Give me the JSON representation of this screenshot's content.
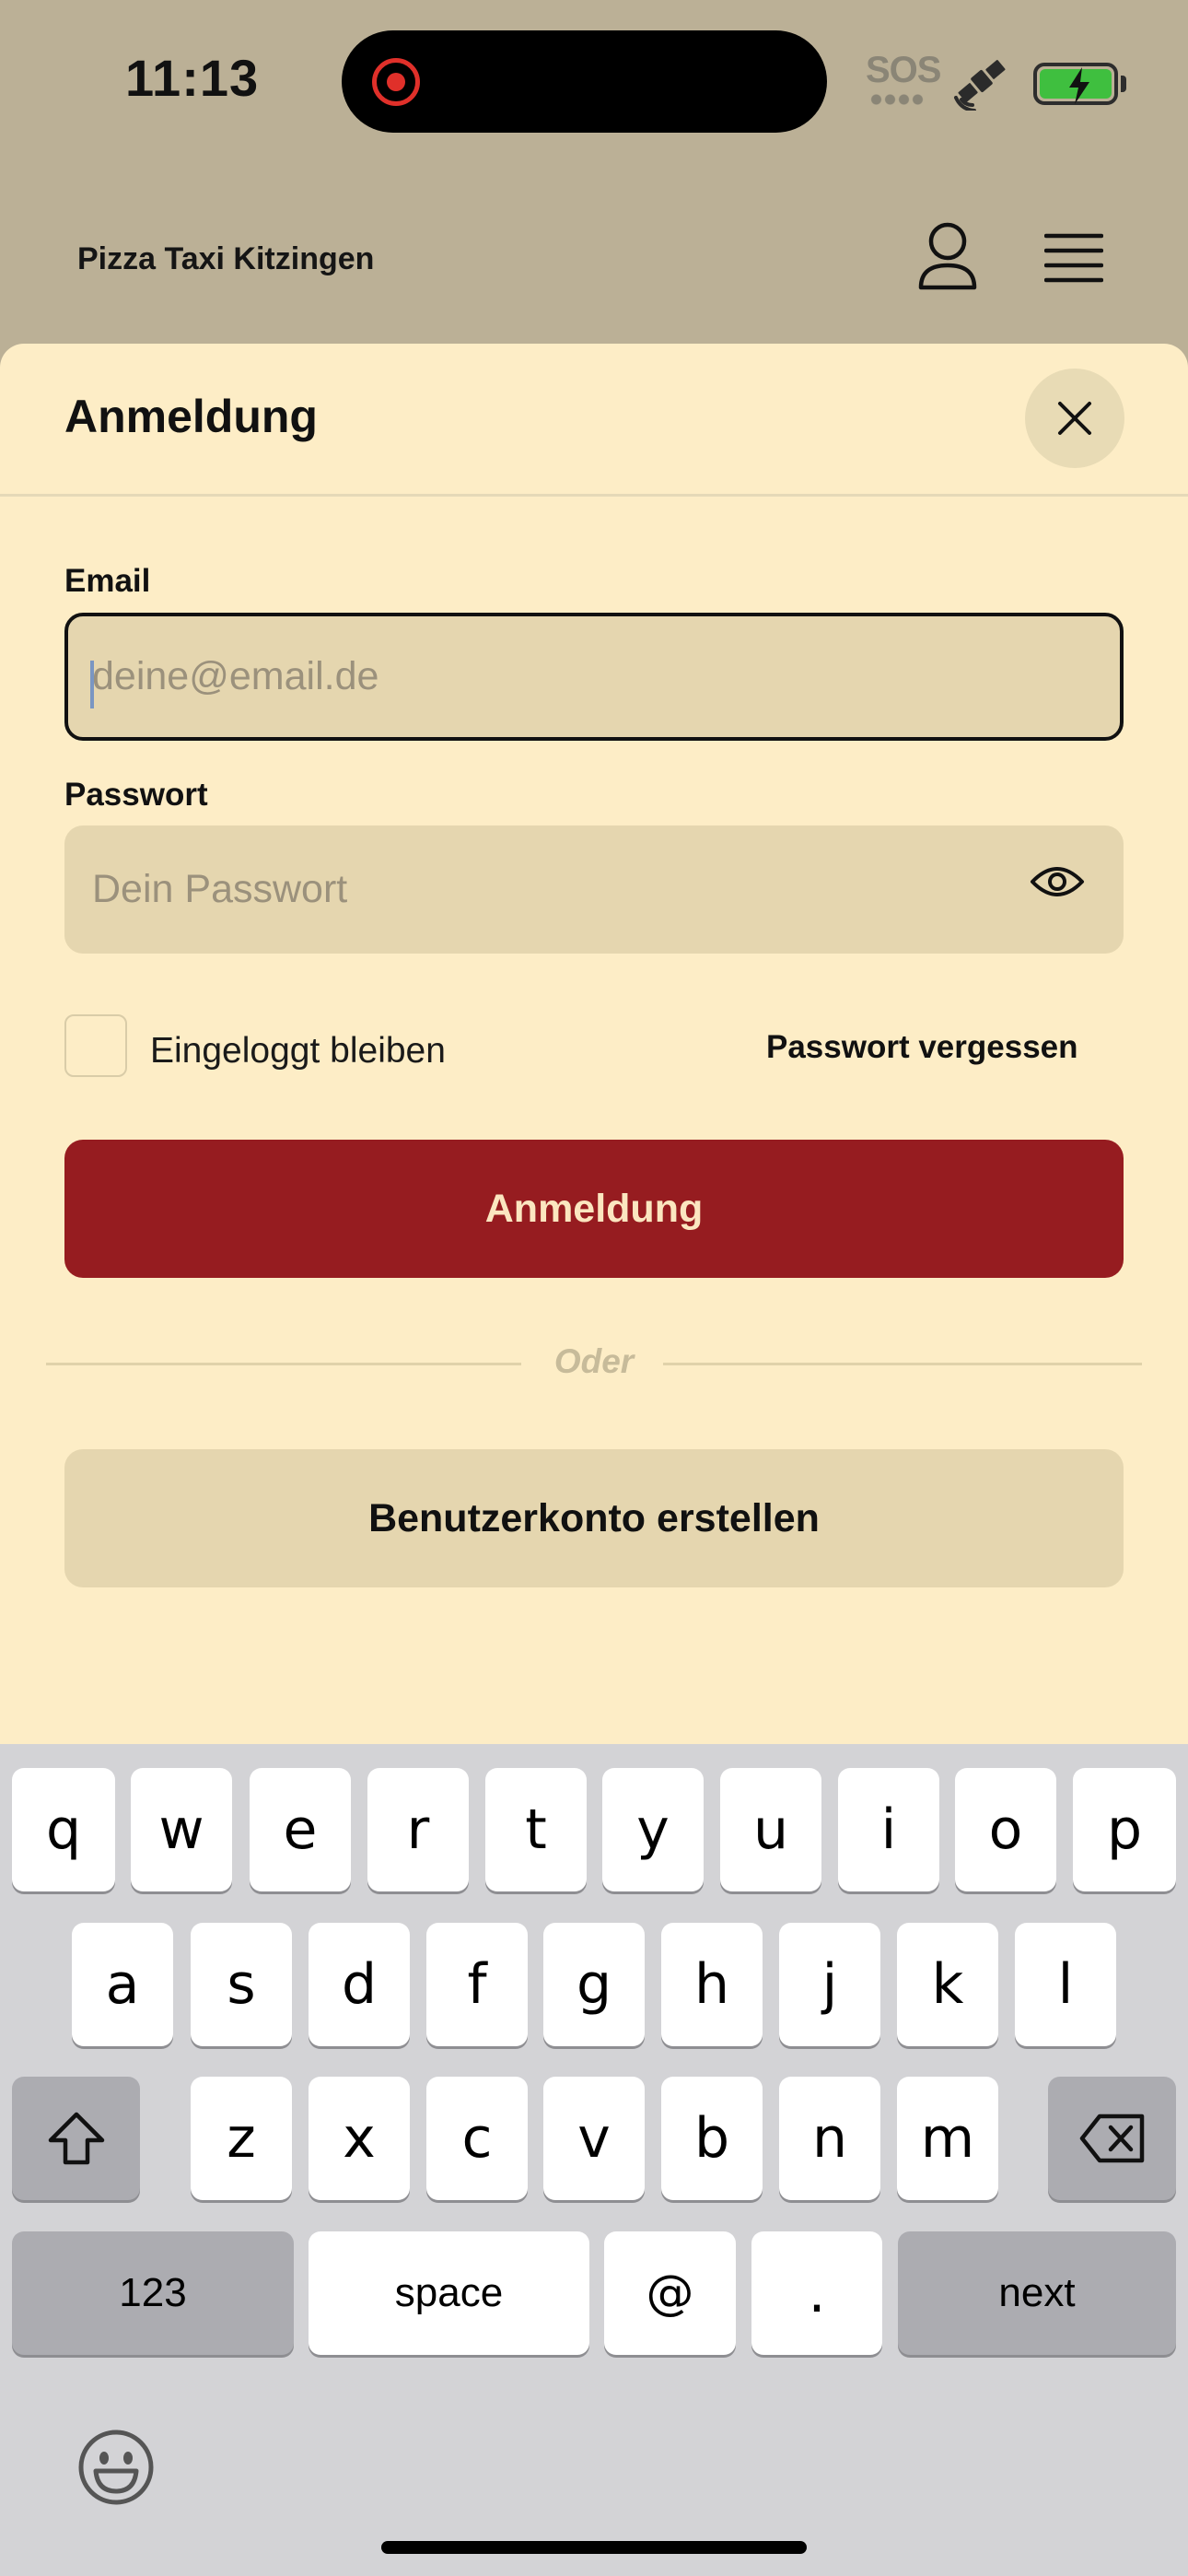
{
  "status_bar": {
    "time": "11:13",
    "sos": "SOS"
  },
  "header": {
    "title": "Pizza Taxi Kitzingen"
  },
  "login_sheet": {
    "title": "Anmeldung",
    "email": {
      "label": "Email",
      "placeholder": "deine@email.de",
      "value": ""
    },
    "password": {
      "label": "Passwort",
      "placeholder": "Dein Passwort",
      "value": ""
    },
    "remember_label": "Eingeloggt bleiben",
    "remember_checked": false,
    "forgot_link": "Passwort vergessen",
    "submit_label": "Anmeldung",
    "divider_text": "Oder",
    "register_label": "Benutzerkonto erstellen"
  },
  "colors": {
    "primary": "#961c20",
    "sheet_bg": "#fdedc6",
    "field_bg": "#e5d6af",
    "header_bg": "#bbb096"
  },
  "keyboard": {
    "row1": [
      "q",
      "w",
      "e",
      "r",
      "t",
      "y",
      "u",
      "i",
      "o",
      "p"
    ],
    "row2": [
      "a",
      "s",
      "d",
      "f",
      "g",
      "h",
      "j",
      "k",
      "l"
    ],
    "row3": [
      "z",
      "x",
      "c",
      "v",
      "b",
      "n",
      "m"
    ],
    "numbers_label": "123",
    "space_label": "space",
    "at_label": "@",
    "dot_label": ".",
    "next_label": "next",
    "shift_icon": "shift-icon",
    "delete_icon": "delete-icon",
    "emoji_icon": "emoji-icon"
  }
}
